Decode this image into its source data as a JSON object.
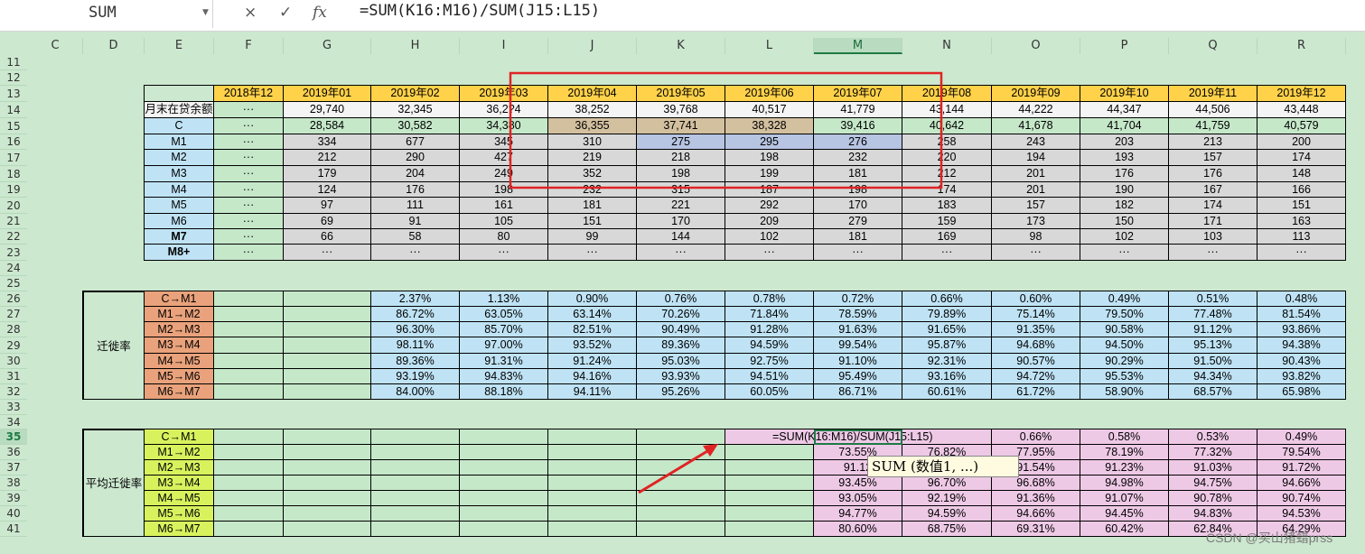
{
  "formula_bar": {
    "name_box": "SUM",
    "cancel_icon": "×",
    "enter_icon": "✓",
    "fx_icon": "fx",
    "formula": "=SUM(K16:M16)/SUM(J15:L15)"
  },
  "columns": [
    "C",
    "D",
    "E",
    "F",
    "G",
    "H",
    "I",
    "J",
    "K",
    "L",
    "M",
    "N",
    "O",
    "P",
    "Q",
    "R"
  ],
  "selected_column": "M",
  "rows": [
    "11",
    "12",
    "13",
    "14",
    "15",
    "16",
    "17",
    "18",
    "19",
    "20",
    "21",
    "22",
    "23",
    "24",
    "25",
    "26",
    "27",
    "28",
    "29",
    "30",
    "31",
    "32",
    "33",
    "34",
    "35",
    "36",
    "37",
    "38",
    "39",
    "40",
    "41"
  ],
  "selected_row": "35",
  "table1": {
    "months": [
      "2018年12",
      "2019年01",
      "2019年02",
      "2019年03",
      "2019年04",
      "2019年05",
      "2019年06",
      "2019年07",
      "2019年08",
      "2019年09",
      "2019年10",
      "2019年11",
      "2019年12"
    ],
    "rows": [
      {
        "label": "月末在贷余额",
        "values": [
          "···",
          "29,740",
          "32,345",
          "36,2?4",
          "38,252",
          "39,768",
          "40,517",
          "41,779",
          "43,144",
          "44,222",
          "44,347",
          "44,506",
          "43,448"
        ]
      },
      {
        "label": "C",
        "values": [
          "···",
          "28,584",
          "30,582",
          "34,380",
          "36,355",
          "37,741",
          "38,328",
          "39,416",
          "40,642",
          "41,678",
          "41,704",
          "41,759",
          "40,579"
        ]
      },
      {
        "label": "M1",
        "values": [
          "···",
          "334",
          "677",
          "345",
          "310",
          "275",
          "295",
          "276",
          "258",
          "243",
          "203",
          "213",
          "200"
        ]
      },
      {
        "label": "M2",
        "values": [
          "···",
          "212",
          "290",
          "427",
          "219",
          "218",
          "198",
          "232",
          "220",
          "194",
          "193",
          "157",
          "174"
        ]
      },
      {
        "label": "M3",
        "values": [
          "···",
          "179",
          "204",
          "249",
          "352",
          "198",
          "199",
          "181",
          "212",
          "201",
          "176",
          "176",
          "148"
        ]
      },
      {
        "label": "M4",
        "values": [
          "···",
          "124",
          "176",
          "198",
          "232",
          "315",
          "187",
          "198",
          "174",
          "201",
          "190",
          "167",
          "166"
        ]
      },
      {
        "label": "M5",
        "values": [
          "···",
          "97",
          "111",
          "161",
          "181",
          "221",
          "292",
          "170",
          "183",
          "157",
          "182",
          "174",
          "151"
        ]
      },
      {
        "label": "M6",
        "values": [
          "···",
          "69",
          "91",
          "105",
          "151",
          "170",
          "209",
          "279",
          "159",
          "173",
          "150",
          "171",
          "163"
        ]
      },
      {
        "label": "M7",
        "values": [
          "···",
          "66",
          "58",
          "80",
          "99",
          "144",
          "102",
          "181",
          "169",
          "98",
          "102",
          "103",
          "113"
        ]
      },
      {
        "label": "M8+",
        "values": [
          "···",
          "···",
          "···",
          "···",
          "···",
          "···",
          "···",
          "···",
          "···",
          "···",
          "···",
          "···",
          "···"
        ]
      }
    ]
  },
  "table2": {
    "title": "迁徙率",
    "rows": [
      {
        "label": "C→M1",
        "values": [
          "",
          "",
          "2.37%",
          "1.13%",
          "0.90%",
          "0.76%",
          "0.78%",
          "0.72%",
          "0.66%",
          "0.60%",
          "0.49%",
          "0.51%",
          "0.48%"
        ]
      },
      {
        "label": "M1→M2",
        "values": [
          "",
          "",
          "86.72%",
          "63.05%",
          "63.14%",
          "70.26%",
          "71.84%",
          "78.59%",
          "79.89%",
          "75.14%",
          "79.50%",
          "77.48%",
          "81.54%"
        ]
      },
      {
        "label": "M2→M3",
        "values": [
          "",
          "",
          "96.30%",
          "85.70%",
          "82.51%",
          "90.49%",
          "91.28%",
          "91.63%",
          "91.65%",
          "91.35%",
          "90.58%",
          "91.12%",
          "93.86%"
        ]
      },
      {
        "label": "M3→M4",
        "values": [
          "",
          "",
          "98.11%",
          "97.00%",
          "93.52%",
          "89.36%",
          "94.59%",
          "99.54%",
          "95.87%",
          "94.68%",
          "94.50%",
          "95.13%",
          "94.38%"
        ]
      },
      {
        "label": "M4→M5",
        "values": [
          "",
          "",
          "89.36%",
          "91.31%",
          "91.24%",
          "95.03%",
          "92.75%",
          "91.10%",
          "92.31%",
          "90.57%",
          "90.29%",
          "91.50%",
          "90.43%"
        ]
      },
      {
        "label": "M5→M6",
        "values": [
          "",
          "",
          "93.19%",
          "94.83%",
          "94.16%",
          "93.93%",
          "94.51%",
          "95.49%",
          "93.16%",
          "94.72%",
          "95.53%",
          "94.34%",
          "93.82%"
        ]
      },
      {
        "label": "M6→M7",
        "values": [
          "",
          "",
          "84.00%",
          "88.18%",
          "94.11%",
          "95.26%",
          "60.05%",
          "86.71%",
          "60.61%",
          "61.72%",
          "58.90%",
          "68.57%",
          "65.98%"
        ]
      }
    ]
  },
  "table3": {
    "title": "平均迁徙率",
    "edit_formula": "=SUM(K16:M16)/SUM(J15:L15)",
    "rows": [
      {
        "label": "C→M1",
        "values": [
          "",
          "",
          "",
          "",
          "",
          "",
          "",
          "",
          "",
          "0.66%",
          "0.58%",
          "0.53%",
          "0.49%"
        ]
      },
      {
        "label": "M1→M2",
        "values": [
          "",
          "",
          "",
          "",
          "",
          "",
          "",
          "73.55%",
          "76.82%",
          "77.95%",
          "78.19%",
          "77.32%",
          "79.54%"
        ]
      },
      {
        "label": "M2→M3",
        "values": [
          "",
          "",
          "",
          "",
          "",
          "",
          "",
          "91.12",
          "",
          "91.54%",
          "91.23%",
          "91.03%",
          "91.72%"
        ]
      },
      {
        "label": "M3→M4",
        "values": [
          "",
          "",
          "",
          "",
          "",
          "",
          "",
          "93.45%",
          "96.70%",
          "96.68%",
          "94.98%",
          "94.75%",
          "94.66%"
        ]
      },
      {
        "label": "M4→M5",
        "values": [
          "",
          "",
          "",
          "",
          "",
          "",
          "",
          "93.05%",
          "92.19%",
          "91.36%",
          "91.07%",
          "90.78%",
          "90.74%"
        ]
      },
      {
        "label": "M5→M6",
        "values": [
          "",
          "",
          "",
          "",
          "",
          "",
          "",
          "94.77%",
          "94.59%",
          "94.66%",
          "94.45%",
          "94.83%",
          "94.53%"
        ]
      },
      {
        "label": "M6→M7",
        "values": [
          "",
          "",
          "",
          "",
          "",
          "",
          "",
          "80.60%",
          "68.75%",
          "69.31%",
          "60.42%",
          "62.84%",
          "64.29%"
        ]
      }
    ]
  },
  "tooltip": "SUM (数值1, ...)",
  "watermark": "CSDN @买山猪蜡prss"
}
